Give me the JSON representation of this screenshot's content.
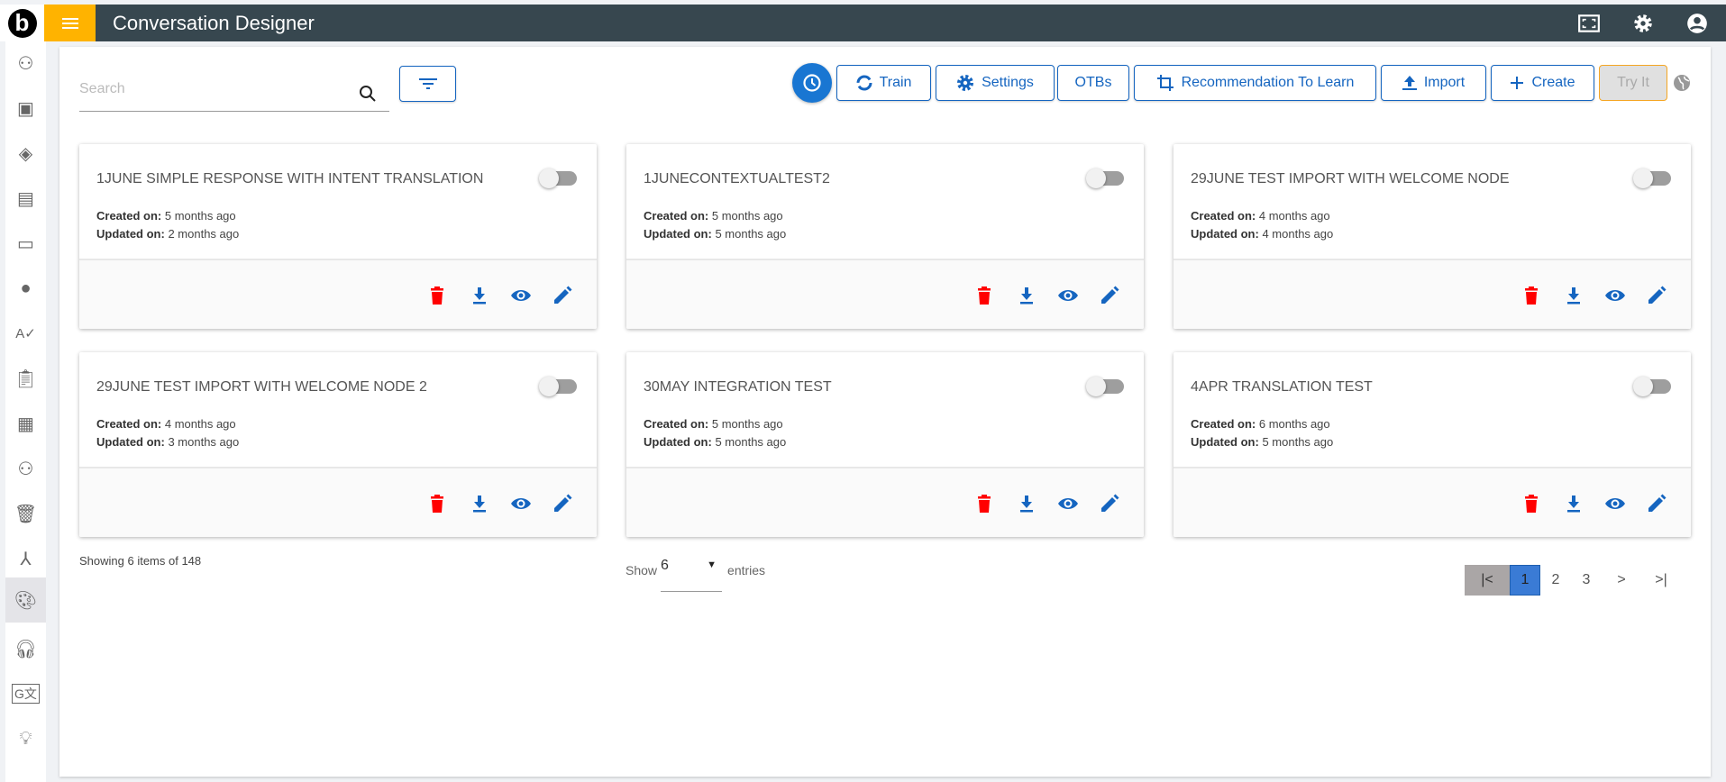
{
  "header": {
    "title": "Conversation Designer",
    "logo_text": "b"
  },
  "sidebar": {
    "items": [
      "bot",
      "contacts",
      "theme",
      "messages",
      "layout",
      "cloud",
      "spellcheck",
      "clipboard",
      "widgets",
      "bot-2",
      "trash",
      "hierarchy",
      "palette",
      "support",
      "translate",
      "ideas"
    ],
    "active": "palette"
  },
  "search": {
    "placeholder": "Search",
    "value": ""
  },
  "toolbar": {
    "train": "Train",
    "settings": "Settings",
    "otbs": "OTBs",
    "recommendation": "Recommendation To Learn",
    "import": "Import",
    "create": "Create",
    "try_it": "Try It"
  },
  "cards": [
    {
      "title": "1JUNE SIMPLE RESPONSE WITH INTENT TRANSLATION",
      "created": "5 months ago",
      "updated": "2 months ago",
      "enabled": false
    },
    {
      "title": "1JUNECONTEXTUALTEST2",
      "created": "5 months ago",
      "updated": "5 months ago",
      "enabled": false
    },
    {
      "title": "29JUNE TEST IMPORT WITH WELCOME NODE",
      "created": "4 months ago",
      "updated": "4 months ago",
      "enabled": false
    },
    {
      "title": "29JUNE TEST IMPORT WITH WELCOME NODE 2",
      "created": "4 months ago",
      "updated": "3 months ago",
      "enabled": false
    },
    {
      "title": "30MAY INTEGRATION TEST",
      "created": "5 months ago",
      "updated": "5 months ago",
      "enabled": false
    },
    {
      "title": "4APR TRANSLATION TEST",
      "created": "6 months ago",
      "updated": "5 months ago",
      "enabled": false
    }
  ],
  "labels": {
    "created": "Created on:",
    "updated": "Updated on:"
  },
  "footer": {
    "showing": "Showing 6 items of 148",
    "show": "Show",
    "entries": "entries",
    "page_size": "6"
  },
  "pagination": {
    "first": "|<",
    "pages": [
      "1",
      "2",
      "3"
    ],
    "current": "1",
    "next": ">",
    "last": ">|"
  },
  "colors": {
    "header": "#37474f",
    "accent": "#ffb300",
    "primary": "#1565c0",
    "danger": "#ff0000"
  }
}
